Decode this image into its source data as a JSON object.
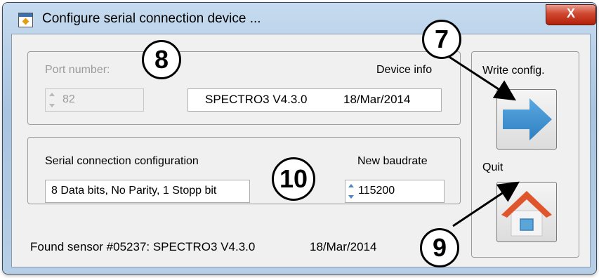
{
  "window": {
    "title": "Configure serial connection device ...",
    "close_symbol": "X"
  },
  "device_group": {
    "port_label": "Port number:",
    "port_value": "82",
    "device_info_label": "Device info",
    "device_name": "SPECTRO3 V4.3.0",
    "device_date": "18/Mar/2014"
  },
  "serial_group": {
    "config_label": "Serial connection configuration",
    "config_value": "8 Data bits, No Parity, 1 Stopp bit",
    "baud_label": "New baudrate",
    "baud_value": "115200"
  },
  "side_panel": {
    "write_label": "Write config.",
    "write_icon": "arrow-right-icon",
    "quit_label": "Quit",
    "quit_icon": "home-icon"
  },
  "status": {
    "sensor_text": "Found sensor #05237: SPECTRO3 V4.3.0",
    "sensor_date": "18/Mar/2014"
  },
  "callouts": [
    "7",
    "8",
    "9",
    "10"
  ],
  "colors": {
    "arrow": "#3b8fd0",
    "roof": "#e0562c",
    "accent_blue": "#4b86c8"
  }
}
